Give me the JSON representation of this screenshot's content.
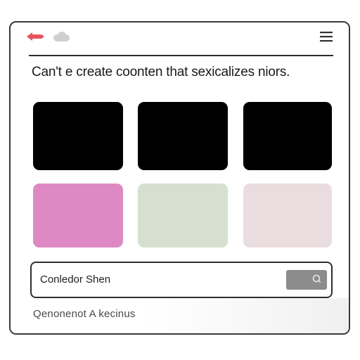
{
  "toolbar": {
    "back_icon": "arrow-left-icon",
    "forward_icon": "cloud-icon",
    "menu_icon": "hamburger-menu-icon",
    "back_color": "#e8535b",
    "forward_color": "#c9c9c9"
  },
  "headline": "Can't e create coonten that sexicalizes niors.",
  "tiles": [
    {
      "color": "#000000"
    },
    {
      "color": "#000000"
    },
    {
      "color": "#000000"
    },
    {
      "color": "#de89c4"
    },
    {
      "color": "#d6e0cf"
    },
    {
      "color": "#eadddf"
    }
  ],
  "search": {
    "value": "Conledor  Shen",
    "button_icon": "search-icon",
    "button_color": "#8c8c8c"
  },
  "footer": {
    "text": "Qenonenot A kecinus"
  }
}
